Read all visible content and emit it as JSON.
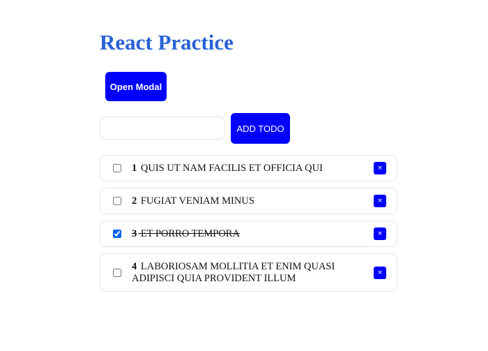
{
  "page": {
    "title": "React Practice",
    "title_color": "#2962d6",
    "accent_color": "#0000ff"
  },
  "toolbar": {
    "open_modal_label": "Open Modal",
    "add_todo_label": "ADD TODO"
  },
  "todo_input": {
    "value": "",
    "placeholder": ""
  },
  "todos": [
    {
      "number": "1",
      "text": "quis ut nam facilis et officia qui",
      "completed": false,
      "delete_icon": "close-icon",
      "delete_glyph": "×"
    },
    {
      "number": "2",
      "text": "fugiat veniam minus",
      "completed": false,
      "delete_icon": "close-icon",
      "delete_glyph": "×"
    },
    {
      "number": "3",
      "text": "et porro tempora",
      "completed": true,
      "delete_icon": "close-icon",
      "delete_glyph": "×"
    },
    {
      "number": "4",
      "text": "laboriosam mollitia et enim quasi adipisci quia provident illum",
      "completed": false,
      "delete_icon": "close-icon",
      "delete_glyph": "×"
    }
  ]
}
